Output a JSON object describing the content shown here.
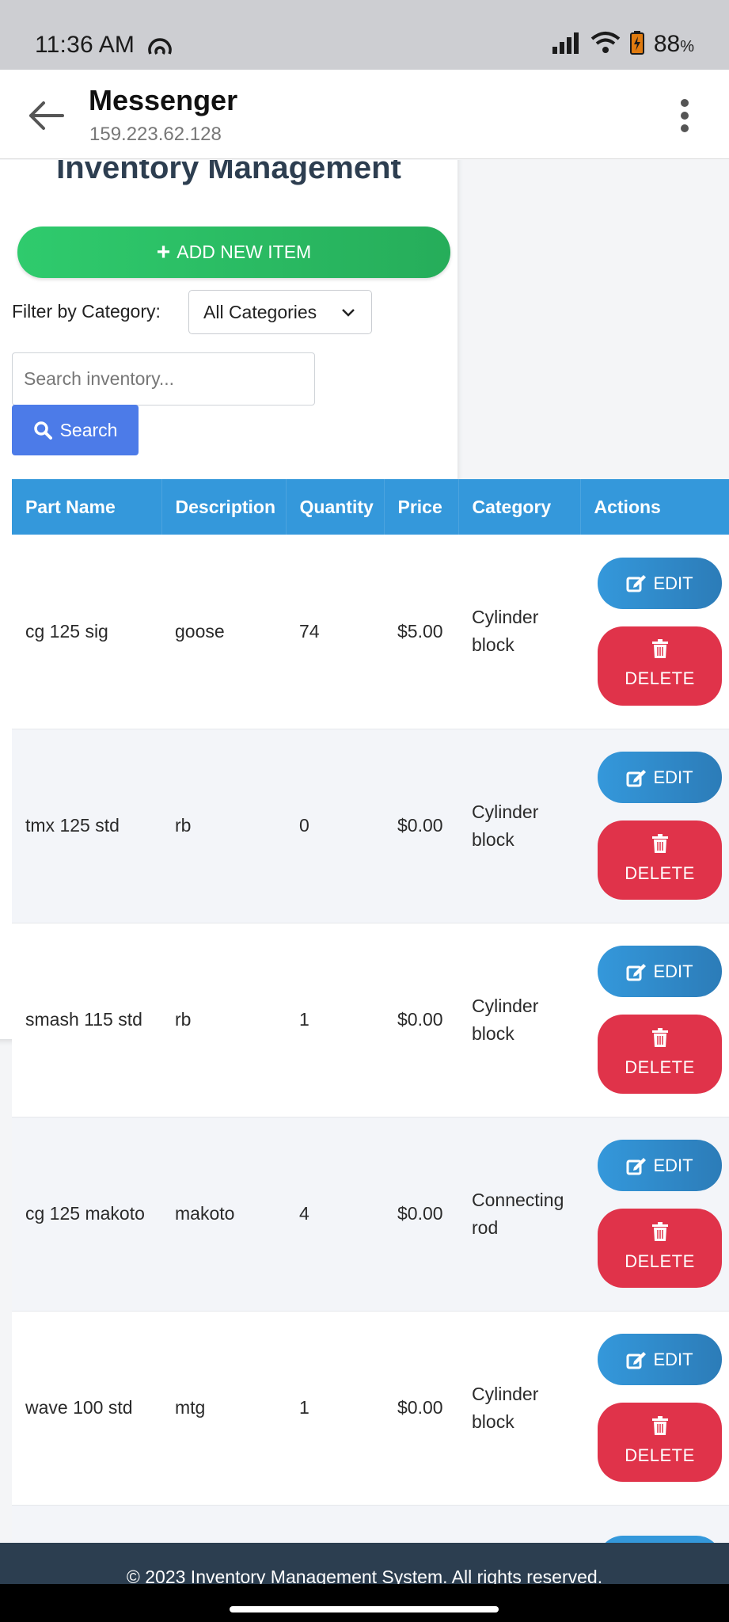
{
  "status_bar": {
    "time": "11:36 AM",
    "battery": "88",
    "battery_unit": "%",
    "icons": [
      "signal-icon",
      "wifi-icon",
      "battery-icon"
    ]
  },
  "app_bar": {
    "title": "Messenger",
    "subtitle": "159.223.62.128"
  },
  "inventory": {
    "title": "Inventory Management",
    "add_button": "ADD NEW ITEM",
    "filter_label": "Filter by Category:",
    "filter_selected": "All Categories",
    "search_placeholder": "Search inventory...",
    "search_button": "Search"
  },
  "table": {
    "headers": [
      "Part Name",
      "Description",
      "Quantity",
      "Price",
      "Category",
      "Actions"
    ],
    "edit_label": "EDIT",
    "delete_label": "DELETE",
    "rows": [
      {
        "part_name": "cg 125 sig",
        "description": "goose",
        "quantity": "74",
        "price": "$5.00",
        "category": "Cylinder block"
      },
      {
        "part_name": "tmx 125 std",
        "description": "rb",
        "quantity": "0",
        "price": "$0.00",
        "category": "Cylinder block"
      },
      {
        "part_name": "smash 115 std",
        "description": "rb",
        "quantity": "1",
        "price": "$0.00",
        "category": "Cylinder block"
      },
      {
        "part_name": "cg 125 makoto",
        "description": "makoto",
        "quantity": "4",
        "price": "$0.00",
        "category": "Connecting rod"
      },
      {
        "part_name": "wave 100 std",
        "description": "mtg",
        "quantity": "1",
        "price": "$0.00",
        "category": "Cylinder block"
      }
    ]
  },
  "footer": {
    "text": "© 2023 Inventory Management System. All rights reserved."
  },
  "colors": {
    "header_blue": "#3498db",
    "add_green": "#2fcb6d",
    "delete_red": "#e0334a",
    "search_blue": "#4c7be8",
    "footer_dark": "#2c3e50"
  }
}
